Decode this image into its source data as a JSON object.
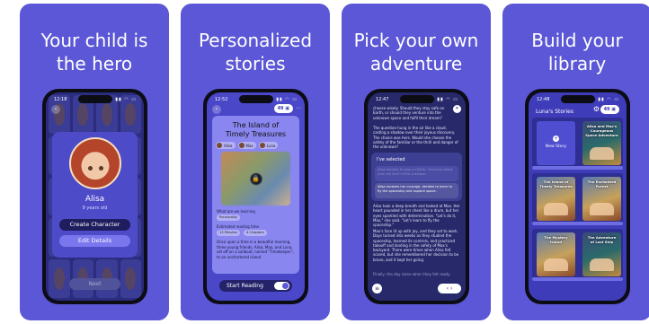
{
  "panels": [
    {
      "headline": "Your child is\nthe hero",
      "time": "12:18",
      "character": {
        "name": "Alisa",
        "age": "9 years old"
      },
      "buttons": {
        "create": "Create Character",
        "edit": "Edit Details",
        "next": "Next"
      }
    },
    {
      "headline": "Personalized\nstories",
      "time": "12:52",
      "credits": "49",
      "story_title": "The Island of\nTimely Treasures",
      "characters": [
        "Alisa",
        "Max",
        "Luna"
      ],
      "learning_label": "What are we learning",
      "learning_tag": "Punctuality",
      "reading_label": "Estimated reading time",
      "reading_tags": [
        "13 Minutes",
        "4 Chapters"
      ],
      "story_excerpt": "Once upon a time in a beautiful morning, three young friends, Alisa, Max, and Luna, set off on a sailboat, named \"Timekeeper\", to an unchartered island",
      "start_button": "Start Reading"
    },
    {
      "headline": "Pick your own\nadventure",
      "time": "12:47",
      "text_top": "choose wisely. Should they stay safe on Earth, or should they venture into the unknown space and fulfil their dream?",
      "text_top2": "The question hung in the air like a cloud, casting a shadow over their joyous discovery. The choice was hers. Would she choose the safety of the familiar or the thrill and danger of the unknown?",
      "choice_heading": "I've selected",
      "choice_faded": "Alisa decides to stay on Earth, choosing safety over the thrill of the unknown.",
      "choice_selected": "Alisa musters her courage, decides to learn to fly the spaceship and explore space.",
      "text_bottom": "Alisa took a deep breath and looked at Max. Her heart pounded in her chest like a drum, but her eyes sparkled with determination. \"Let's do it, Max,\" she said. \"Let's learn to fly the spaceship.\"",
      "text_bottom2": "Max's face lit up with joy, and they set to work. Days turned into weeks as they studied the spaceship, learned its controls, and practiced takeoff and landing in the safety of Max's backyard. There were times when Alisa felt scared, but she remembered her decision to be brave, and it kept her going.",
      "text_bottom3": "Finally, the day came when they felt ready."
    },
    {
      "headline": "Build your\nlibrary",
      "time": "12:48",
      "credits": "49",
      "library_title": "Luna's Stories",
      "new_story": "New Story",
      "books": [
        "Alisa and Max's Courageous Space Adventure",
        "The Island of Timely Treasures",
        "The Enchanted Forest",
        "The Mystery Island",
        "The Adventure of Lost Ship"
      ]
    }
  ]
}
